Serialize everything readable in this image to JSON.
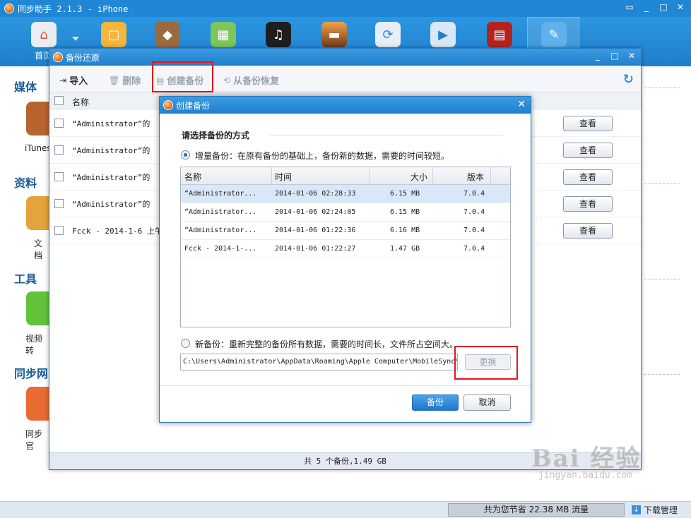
{
  "app": {
    "title": "同步助手 2.1.3 - iPhone",
    "home_label": "首页",
    "window_controls": [
      "message-icon",
      "minimize-icon",
      "maximize-icon",
      "close-icon"
    ]
  },
  "toolbar_icons": [
    "home-icon",
    "shopping-bag-icon",
    "pineapple-app-icon",
    "apps-grid-icon",
    "music-icon",
    "photos-icon",
    "sync-icon",
    "video-icon",
    "book-icon",
    "tools-icon"
  ],
  "sidebar": {
    "cat_media": "媒体",
    "itunes_label": "iTunes",
    "cat_data": "资料",
    "docs_label": "文档",
    "cat_tools": "工具",
    "video_label": "视频转",
    "cat_sync": "同步网",
    "site_label": "同步官"
  },
  "status": {
    "savings": "共为您节省 22.38 MB 流量",
    "download_mgr": "下载管理"
  },
  "backup_window": {
    "title": "备份还原",
    "toolbar": {
      "import": "导入",
      "delete": "删除",
      "create": "创建备份",
      "restore": "从备份恢复"
    },
    "column_name": "名称",
    "rows": [
      {
        "name": "“Administrator”的",
        "view": "查看"
      },
      {
        "name": "“Administrator”的",
        "view": "查看"
      },
      {
        "name": "“Administrator”的",
        "view": "查看"
      },
      {
        "name": "“Administrator”的",
        "view": "查看"
      },
      {
        "name": "Fcck - 2014-1-6 上午",
        "view": "查看"
      }
    ],
    "footer": "共 5 个备份,1.49 GB"
  },
  "dialog": {
    "title": "创建备份",
    "heading": "请选择备份的方式",
    "incremental_label": "增量备份：在原有备份的基础上，备份新的数据，需要的时间较短。",
    "columns": {
      "name": "名称",
      "time": "时间",
      "size": "大小",
      "version": "版本"
    },
    "rows": [
      {
        "name": "“Administrator...",
        "time": "2014-01-06 02:28:33",
        "size": "6.15 MB",
        "version": "7.0.4",
        "selected": true
      },
      {
        "name": "“Administrator...",
        "time": "2014-01-06 02:24:05",
        "size": "6.15 MB",
        "version": "7.0.4",
        "selected": false
      },
      {
        "name": "“Administrator...",
        "time": "2014-01-06 01:22:36",
        "size": "6.16 MB",
        "version": "7.0.4",
        "selected": false
      },
      {
        "name": "Fcck - 2014-1-...",
        "time": "2014-01-06 01:22:27",
        "size": "1.47 GB",
        "version": "7.0.4",
        "selected": false
      }
    ],
    "new_label": "新备份：重新完整的备份所有数据，需要的时间长，文件所占空间大。",
    "path": "C:\\Users\\Administrator\\AppData\\Roaming\\Apple Computer\\MobileSync\\",
    "change_button": "更换",
    "backup_button": "备份",
    "cancel_button": "取消"
  },
  "watermark": {
    "brand": "Bai 经验",
    "url": "jingyan.baidu.com"
  },
  "colors": {
    "titlebar_blue": "#1f87d6",
    "highlight_red": "#e4141b",
    "selected_row": "#d9e8f8"
  }
}
